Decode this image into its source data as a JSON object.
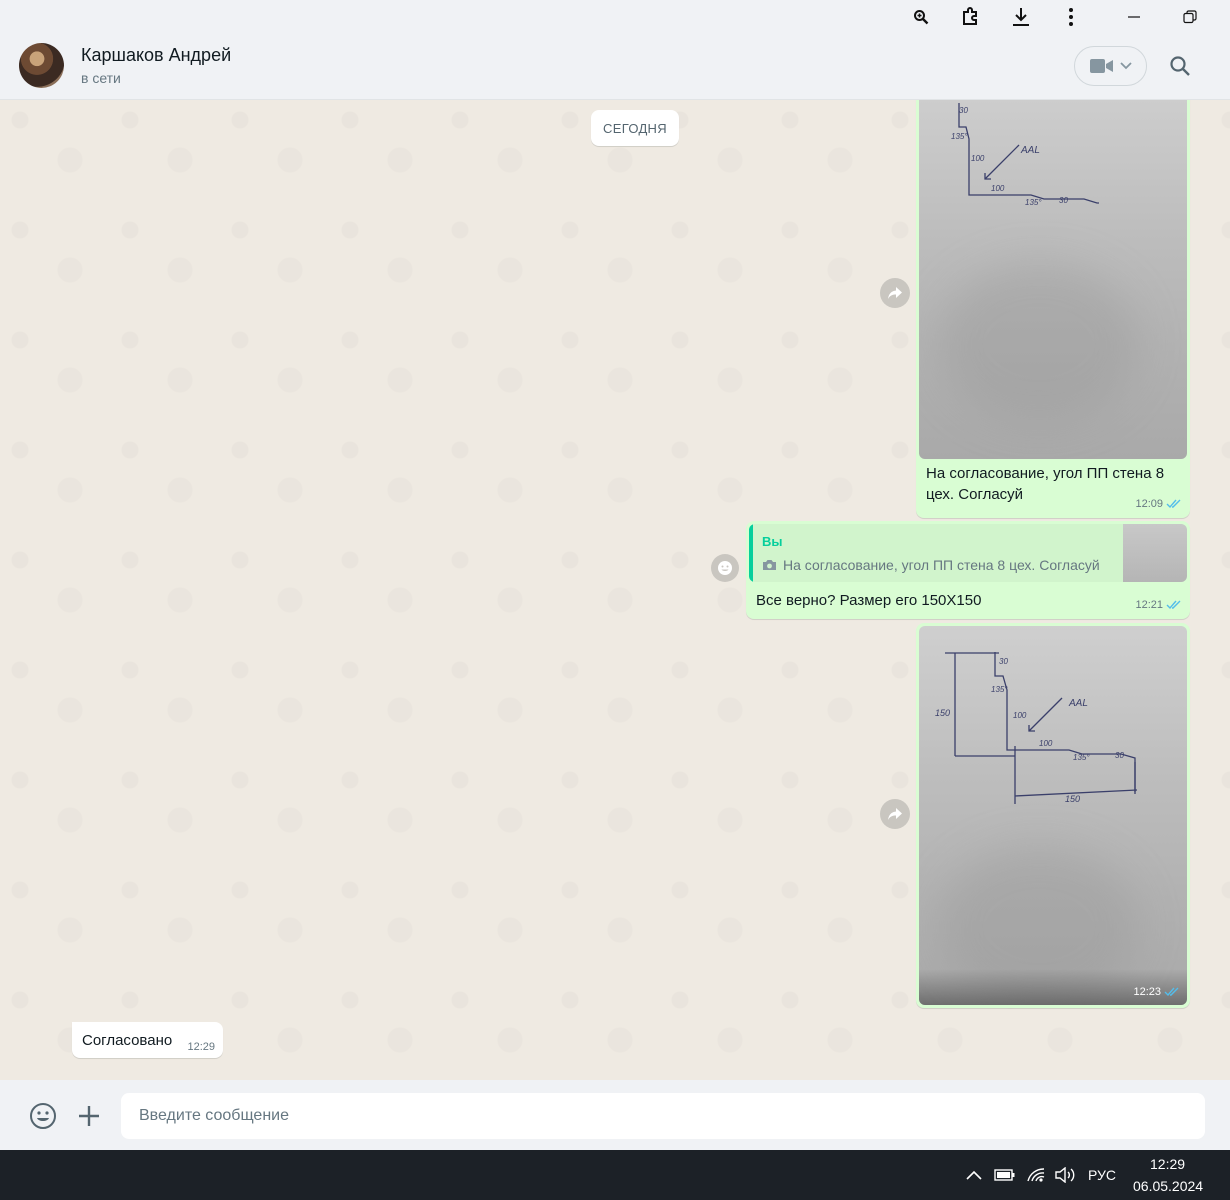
{
  "header": {
    "contact_name": "Каршаков Андрей",
    "status": "в сети"
  },
  "chat": {
    "date_label": "СЕГОДНЯ",
    "messages": [
      {
        "direction": "out",
        "type": "image",
        "caption": "На согласование, угол ПП стена 8 цех. Согласуй",
        "time": "12:09",
        "status": "read"
      },
      {
        "direction": "out",
        "type": "text",
        "reply_author": "Вы",
        "reply_text": "На согласование, угол ПП стена 8 цех. Согласуй",
        "text": "Все верно? Размер его 150Х150",
        "time": "12:21",
        "status": "read"
      },
      {
        "direction": "out",
        "type": "image",
        "caption": "",
        "time": "12:23",
        "status": "read"
      },
      {
        "direction": "in",
        "type": "text",
        "text": "Согласовано",
        "time": "12:29"
      }
    ],
    "sketch1_labels": [
      "30",
      "135°",
      "100",
      "AAL",
      "100",
      "135°",
      "30"
    ],
    "sketch2_labels": [
      "30",
      "135°",
      "150",
      "100",
      "AAL",
      "100",
      "135°",
      "30",
      "150"
    ]
  },
  "composer": {
    "placeholder": "Введите сообщение"
  },
  "taskbar": {
    "language": "РУС",
    "time": "12:29",
    "date": "06.05.2024"
  },
  "colors": {
    "outgoing_bubble": "#d9fdd3",
    "incoming_bubble": "#ffffff",
    "read_ticks": "#53bdeb",
    "accent": "#06cf9c"
  }
}
